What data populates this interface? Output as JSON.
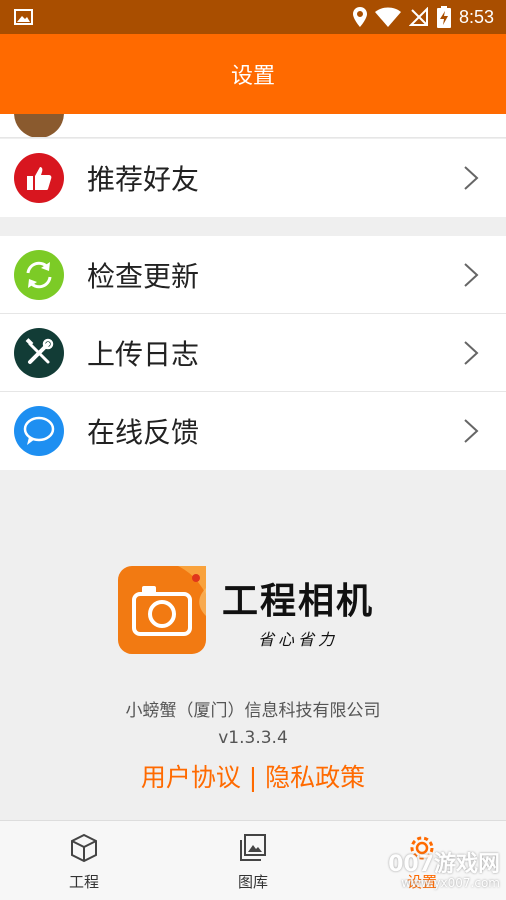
{
  "status_bar": {
    "time": "8:53"
  },
  "app_bar": {
    "title": "设置"
  },
  "groups": [
    {
      "items": [
        {
          "label": "推荐好友",
          "icon": "thumbs-up-icon",
          "color": "#d8161f"
        }
      ]
    },
    {
      "items": [
        {
          "label": "检查更新",
          "icon": "refresh-icon",
          "color": "#7ccb26"
        },
        {
          "label": "上传日志",
          "icon": "tools-icon",
          "color": "#123c36"
        },
        {
          "label": "在线反馈",
          "icon": "chat-bubble-icon",
          "color": "#1e8ff1"
        }
      ]
    }
  ],
  "brand": {
    "name": "工程相机",
    "slogan": "省心省力",
    "company": "小螃蟹（厦门）信息科技有限公司",
    "version": "v1.3.3.4",
    "links_text": "用户协议 | 隐私政策"
  },
  "tabs": [
    {
      "label": "工程",
      "icon": "cube-icon"
    },
    {
      "label": "图库",
      "icon": "gallery-icon"
    },
    {
      "label": "设置",
      "icon": "gear-icon",
      "active": true
    }
  ],
  "watermark": {
    "line1": "007游戏网",
    "line2": "www.yx007.com"
  },
  "colors": {
    "primary": "#ff6a00",
    "status_bar": "#a94e00"
  }
}
